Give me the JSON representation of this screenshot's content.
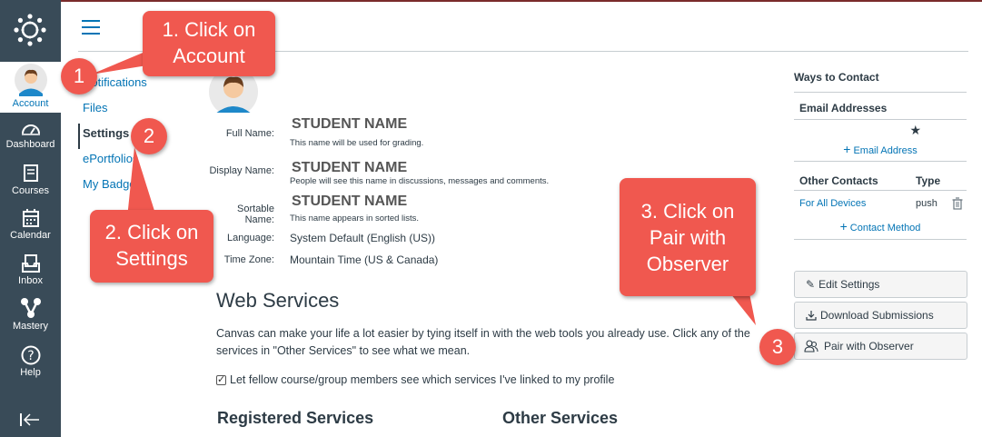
{
  "global_nav": {
    "account": "Account",
    "dashboard": "Dashboard",
    "courses": "Courses",
    "calendar": "Calendar",
    "inbox": "Inbox",
    "mastery": "Mastery",
    "help": "Help"
  },
  "section_nav": {
    "items": [
      {
        "label": "Notifications"
      },
      {
        "label": "Files"
      },
      {
        "label": "Settings"
      },
      {
        "label": "ePortfolios"
      },
      {
        "label": "My Badges"
      }
    ]
  },
  "profile": {
    "full_name_label": "Full Name:",
    "full_name": "STUDENT NAME",
    "full_name_note": "This name will be used for grading.",
    "display_name_label": "Display Name:",
    "display_name": "STUDENT NAME",
    "display_name_note": "People will see this name in discussions, messages and comments.",
    "sortable_name_label": "Sortable Name:",
    "sortable_name": "STUDENT NAME",
    "sortable_name_note": "This name appears in sorted lists.",
    "language_label": "Language:",
    "language": "System Default (English (US))",
    "time_zone_label": "Time Zone:",
    "time_zone": "Mountain Time (US & Canada)"
  },
  "web_services": {
    "title": "Web Services",
    "description": "Canvas can make your life a lot easier by tying itself in with the web tools you already use. Click any of the services in \"Other Services\" to see what we mean.",
    "checkbox_label": "Let fellow course/group members see which services I've linked to my profile",
    "checkbox_checked": true,
    "registered_title": "Registered Services",
    "other_title": "Other Services"
  },
  "sidebar": {
    "ways_to_contact": "Ways to Contact",
    "email_addresses": "Email Addresses",
    "star": "★",
    "add_email": "Email Address",
    "other_contacts": "Other Contacts",
    "type_header": "Type",
    "contact_name": "For All Devices",
    "contact_type": "push",
    "add_contact": "Contact Method",
    "edit_settings": "Edit Settings",
    "download_submissions": "Download Submissions",
    "pair_with_observer": "Pair with Observer"
  },
  "callouts": {
    "c1_line1": "1. Click on",
    "c1_line2": "Account",
    "c2_line1": "2. Click on",
    "c2_line2": "Settings",
    "c3_line1": "3. Click on",
    "c3_line2": "Pair with",
    "c3_line3": "Observer",
    "n1": "1",
    "n2": "2",
    "n3": "3"
  },
  "colors": {
    "nav_bg": "#394b58",
    "link": "#0374b5",
    "callout": "#f0584f"
  }
}
